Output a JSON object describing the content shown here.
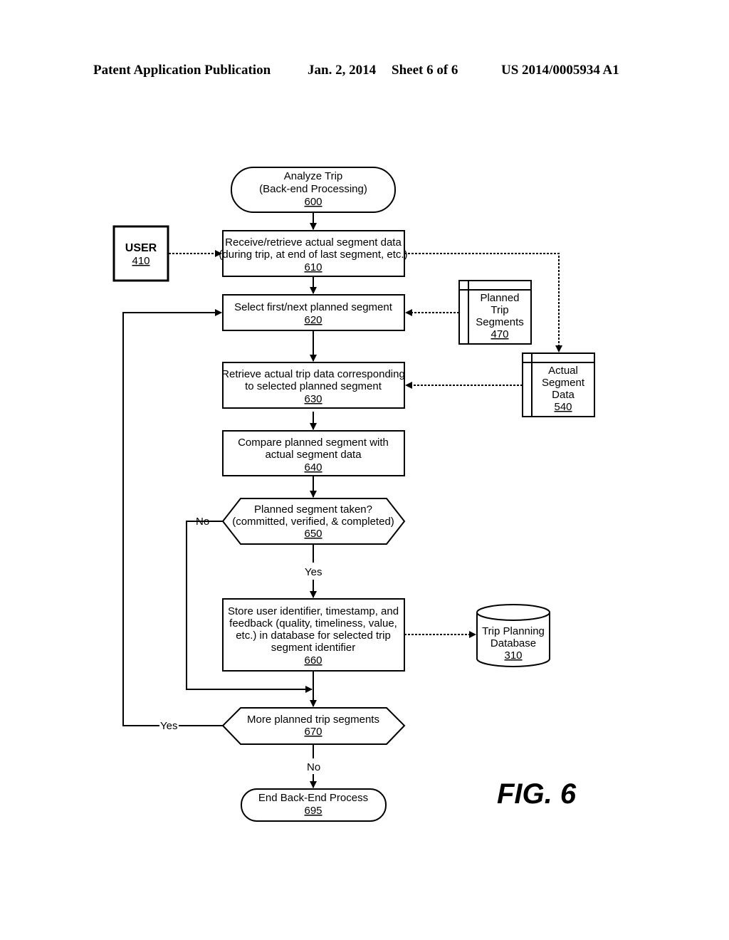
{
  "header": {
    "publication": "Patent Application Publication",
    "date": "Jan. 2, 2014",
    "sheet": "Sheet 6 of 6",
    "number": "US 2014/0005934 A1"
  },
  "figure_label": "FIG. 6",
  "nodes": {
    "start": {
      "lines": [
        "Analyze Trip",
        "(Back-end Processing)"
      ],
      "ref": "600"
    },
    "user": {
      "lines": [
        "USER"
      ],
      "ref": "410"
    },
    "n610": {
      "lines": [
        "Receive/retrieve actual segment data",
        "(during trip, at end of last segment, etc.)"
      ],
      "ref": "610"
    },
    "n620": {
      "lines": [
        "Select first/next planned segment"
      ],
      "ref": "620"
    },
    "n630": {
      "lines": [
        "Retrieve actual trip data corresponding",
        "to selected planned segment"
      ],
      "ref": "630"
    },
    "n640": {
      "lines": [
        "Compare planned segment with",
        "actual segment data"
      ],
      "ref": "640"
    },
    "n650": {
      "lines": [
        "Planned segment taken?",
        "(committed, verified, & completed)"
      ],
      "ref": "650"
    },
    "n660": {
      "lines": [
        "Store user identifier, timestamp, and",
        "feedback (quality, timeliness, value,",
        "etc.) in database for selected trip",
        "segment identifier"
      ],
      "ref": "660"
    },
    "n670": {
      "lines": [
        "More planned trip segments"
      ],
      "ref": "670"
    },
    "end": {
      "lines": [
        "End Back-End Process"
      ],
      "ref": "695"
    },
    "planned_trip_segments": {
      "lines": [
        "Planned",
        "Trip",
        "Segments"
      ],
      "ref": "470"
    },
    "actual_segment_data": {
      "lines": [
        "Actual",
        "Segment",
        "Data"
      ],
      "ref": "540"
    },
    "trip_planning_db": {
      "lines": [
        "Trip Planning",
        "Database"
      ],
      "ref": "310"
    }
  },
  "edge_labels": {
    "n650_no": "No",
    "n650_yes": "Yes",
    "n670_yes": "Yes",
    "n670_no": "No"
  }
}
